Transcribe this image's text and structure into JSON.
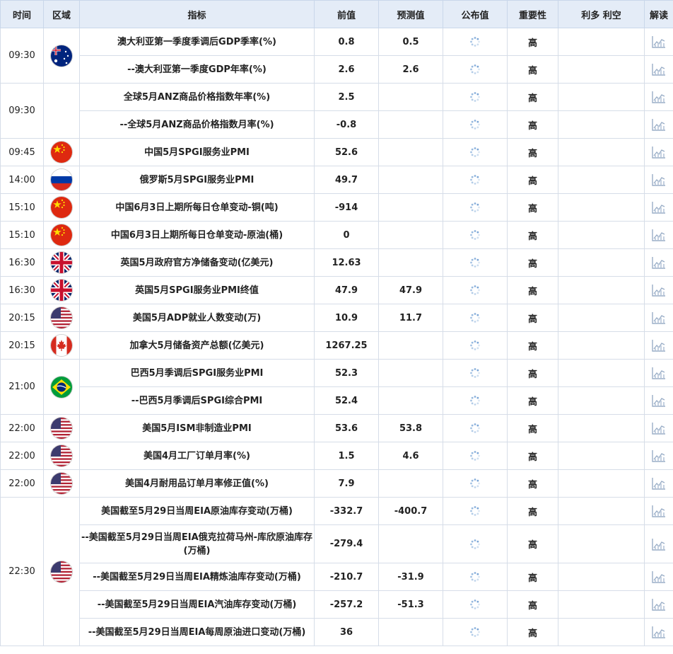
{
  "headers": {
    "time": "时间",
    "region": "区域",
    "indicator": "指标",
    "prev": "前值",
    "forecast": "预测值",
    "actual": "公布值",
    "importance": "重要性",
    "effect": "利多 利空",
    "interpret": "解读"
  },
  "groups": [
    {
      "time": "09:30",
      "flag": "australia-flag",
      "rows": [
        {
          "name": "澳大利亚第一季度季调后GDP季率(%)",
          "prev": "0.8",
          "forecast": "0.5",
          "actual": "",
          "importance": "高",
          "effect": ""
        },
        {
          "name": "--澳大利亚第一季度GDP年率(%)",
          "prev": "2.6",
          "forecast": "2.6",
          "actual": "",
          "importance": "高",
          "effect": ""
        }
      ]
    },
    {
      "time": "09:30",
      "flag": "",
      "rows": [
        {
          "name": "全球5月ANZ商品价格指数年率(%)",
          "prev": "2.5",
          "forecast": "",
          "actual": "",
          "importance": "高",
          "effect": ""
        },
        {
          "name": "--全球5月ANZ商品价格指数月率(%)",
          "prev": "-0.8",
          "forecast": "",
          "actual": "",
          "importance": "高",
          "effect": ""
        }
      ]
    },
    {
      "time": "09:45",
      "flag": "china-flag",
      "rows": [
        {
          "name": "中国5月SPGI服务业PMI",
          "prev": "52.6",
          "forecast": "",
          "actual": "",
          "importance": "高",
          "effect": ""
        }
      ]
    },
    {
      "time": "14:00",
      "flag": "russia-flag",
      "rows": [
        {
          "name": "俄罗斯5月SPGI服务业PMI",
          "prev": "49.7",
          "forecast": "",
          "actual": "",
          "importance": "高",
          "effect": ""
        }
      ]
    },
    {
      "time": "15:10",
      "flag": "china-flag",
      "rows": [
        {
          "name": "中国6月3日上期所每日仓单变动-铜(吨)",
          "prev": "-914",
          "forecast": "",
          "actual": "",
          "importance": "高",
          "effect": ""
        }
      ]
    },
    {
      "time": "15:10",
      "flag": "china-flag",
      "rows": [
        {
          "name": "中国6月3日上期所每日仓单变动-原油(桶)",
          "prev": "0",
          "forecast": "",
          "actual": "",
          "importance": "高",
          "effect": ""
        }
      ]
    },
    {
      "time": "16:30",
      "flag": "uk-flag",
      "rows": [
        {
          "name": "英国5月政府官方净储备变动(亿美元)",
          "prev": "12.63",
          "forecast": "",
          "actual": "",
          "importance": "高",
          "effect": ""
        }
      ]
    },
    {
      "time": "16:30",
      "flag": "uk-flag",
      "rows": [
        {
          "name": "英国5月SPGI服务业PMI终值",
          "prev": "47.9",
          "forecast": "47.9",
          "actual": "",
          "importance": "高",
          "effect": ""
        }
      ]
    },
    {
      "time": "20:15",
      "flag": "usa-flag",
      "rows": [
        {
          "name": "美国5月ADP就业人数变动(万)",
          "prev": "10.9",
          "forecast": "11.7",
          "actual": "",
          "importance": "高",
          "effect": ""
        }
      ]
    },
    {
      "time": "20:15",
      "flag": "canada-flag",
      "rows": [
        {
          "name": "加拿大5月储备资产总额(亿美元)",
          "prev": "1267.25",
          "forecast": "",
          "actual": "",
          "importance": "高",
          "effect": ""
        }
      ]
    },
    {
      "time": "21:00",
      "flag": "brazil-flag",
      "rows": [
        {
          "name": "巴西5月季调后SPGI服务业PMI",
          "prev": "52.3",
          "forecast": "",
          "actual": "",
          "importance": "高",
          "effect": ""
        },
        {
          "name": "--巴西5月季调后SPGI综合PMI",
          "prev": "52.4",
          "forecast": "",
          "actual": "",
          "importance": "高",
          "effect": ""
        }
      ]
    },
    {
      "time": "22:00",
      "flag": "usa-flag",
      "rows": [
        {
          "name": "美国5月ISM非制造业PMI",
          "prev": "53.6",
          "forecast": "53.8",
          "actual": "",
          "importance": "高",
          "effect": ""
        }
      ]
    },
    {
      "time": "22:00",
      "flag": "usa-flag",
      "rows": [
        {
          "name": "美国4月工厂订单月率(%)",
          "prev": "1.5",
          "forecast": "4.6",
          "actual": "",
          "importance": "高",
          "effect": ""
        }
      ]
    },
    {
      "time": "22:00",
      "flag": "usa-flag",
      "rows": [
        {
          "name": "美国4月耐用品订单月率修正值(%)",
          "prev": "7.9",
          "forecast": "",
          "actual": "",
          "importance": "高",
          "effect": ""
        }
      ]
    },
    {
      "time": "22:30",
      "flag": "usa-flag",
      "rows": [
        {
          "name": "美国截至5月29日当周EIA原油库存变动(万桶)",
          "prev": "-332.7",
          "forecast": "-400.7",
          "actual": "",
          "importance": "高",
          "effect": ""
        },
        {
          "name": "--美国截至5月29日当周EIA俄克拉荷马州-库欣原油库存(万桶)",
          "prev": "-279.4",
          "forecast": "",
          "actual": "",
          "importance": "高",
          "effect": ""
        },
        {
          "name": "--美国截至5月29日当周EIA精炼油库存变动(万桶)",
          "prev": "-210.7",
          "forecast": "-31.9",
          "actual": "",
          "importance": "高",
          "effect": ""
        },
        {
          "name": "--美国截至5月29日当周EIA汽油库存变动(万桶)",
          "prev": "-257.2",
          "forecast": "-51.3",
          "actual": "",
          "importance": "高",
          "effect": ""
        },
        {
          "name": "--美国截至5月29日当周EIA每周原油进口变动(万桶)",
          "prev": "36",
          "forecast": "",
          "actual": "",
          "importance": "高",
          "effect": ""
        }
      ]
    }
  ],
  "icons": {
    "pending": "loading-spinner-icon",
    "chart": "chart-icon"
  },
  "colors": {
    "value_text": "#c6211b",
    "header_bg": "#e4ecf7",
    "grid": "#d6dde8"
  }
}
